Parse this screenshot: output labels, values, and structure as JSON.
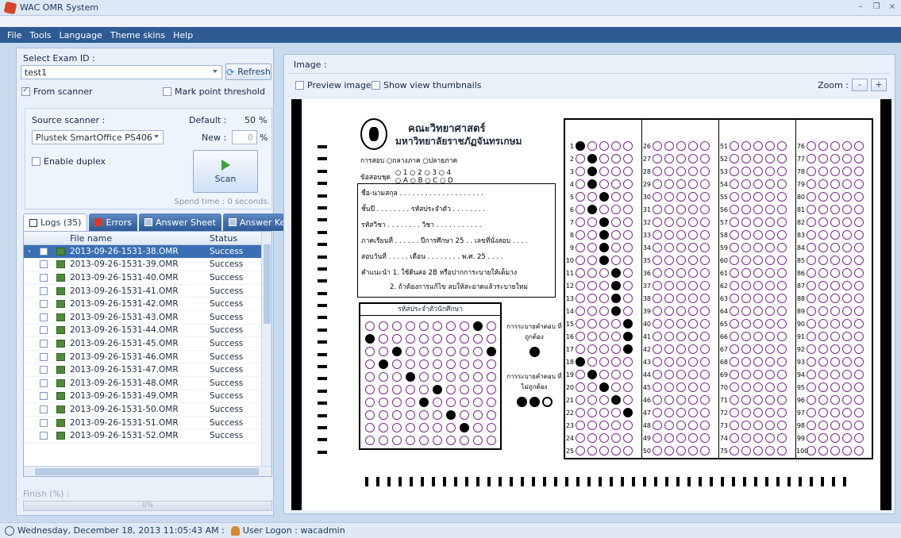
{
  "window": {
    "title": "WAC OMR System"
  },
  "menu": [
    "File",
    "Tools",
    "Language",
    "Theme skins",
    "Help"
  ],
  "left": {
    "select_exam_label": "Select Exam ID :",
    "exam_id": "test1",
    "refresh_label": "Refresh",
    "from_scanner_label": "From scanner",
    "from_scanner_checked": true,
    "mark_threshold_label": "Mark point threshold",
    "source_scanner_label": "Source scanner :",
    "source_scanner_value": "Plustek SmartOffice PS406",
    "default_label": "Default :",
    "default_value": "50",
    "new_label": "New :",
    "new_value": "0",
    "percent": "%",
    "enable_duplex_label": "Enable duplex",
    "scan_label": "Scan",
    "spend_time": "Spend time : 0 seconds.",
    "tabs": [
      {
        "label": "Logs (35)"
      },
      {
        "label": "Errors"
      },
      {
        "label": "Answer Sheet"
      },
      {
        "label": "Answer Key"
      }
    ],
    "columns": {
      "file": "File name",
      "status": "Status"
    },
    "rows": [
      {
        "file": "2013-09-26-1531-38.OMR",
        "status": "Success"
      },
      {
        "file": "2013-09-26-1531-39.OMR",
        "status": "Success"
      },
      {
        "file": "2013-09-26-1531-40.OMR",
        "status": "Success"
      },
      {
        "file": "2013-09-26-1531-41.OMR",
        "status": "Success"
      },
      {
        "file": "2013-09-26-1531-42.OMR",
        "status": "Success"
      },
      {
        "file": "2013-09-26-1531-43.OMR",
        "status": "Success"
      },
      {
        "file": "2013-09-26-1531-44.OMR",
        "status": "Success"
      },
      {
        "file": "2013-09-26-1531-45.OMR",
        "status": "Success"
      },
      {
        "file": "2013-09-26-1531-46.OMR",
        "status": "Success"
      },
      {
        "file": "2013-09-26-1531-47.OMR",
        "status": "Success"
      },
      {
        "file": "2013-09-26-1531-48.OMR",
        "status": "Success"
      },
      {
        "file": "2013-09-26-1531-49.OMR",
        "status": "Success"
      },
      {
        "file": "2013-09-26-1531-50.OMR",
        "status": "Success"
      },
      {
        "file": "2013-09-26-1531-51.OMR",
        "status": "Success"
      },
      {
        "file": "2013-09-26-1531-52.OMR",
        "status": "Success"
      }
    ],
    "finish_label": "Finish (%) :",
    "progress_text": "0%",
    "progress_value": 0
  },
  "right": {
    "image_label": "Image :",
    "preview_label": "Preview image",
    "thumbs_label": "Show view thumbnails",
    "zoom_label": "Zoom :",
    "zoom_out": "-",
    "zoom_in": "+",
    "sheet": {
      "faculty": "คณะวิทยาศาสตร์",
      "university": "มหาวิทยาลัยราชภัฏจันทรเกษม",
      "exam_type": "การสอบ  ○กลางภาค  ○ปลายภาค",
      "set_label": "ข้อสอบชุด",
      "set_options": "○ 1  ○ 2  ○ 3  ○ 4",
      "set_options2": "○ A  ○ B  ○ C  ○ D",
      "info_lines": [
        "ชื่อ-นามสกุล . . . . . . . . . . . . . . . . . . . .",
        "ชั้นปี . . . . . . . . รหัสประจำตัว . . . . . . . .",
        "รหัสวิชา . . . . . . . . วิชา . . . . . . . . . . .",
        "ภาคเรียนที่ . . . . . . ปีการศึกษา 25 . . เลขที่นั่งสอบ . . . .",
        "สอบวันที่ . . . . . เดือน . . . . . . . . พ.ศ. 25 . . . .",
        "คำแนะนำ 1. ใช้ดินสอ 2B หรือปากการะบายให้เต็มวง",
        "2. ถ้าต้องการแก้ไข ลบให้สะอาดแล้วระบายใหม่"
      ],
      "id_title": "รหัสประจำตัวนักศึกษา",
      "legend_ok": "การระบายคำตอบ ที่ถูกต้อง",
      "legend_bad": "การระบายคำตอบ ที่ไม่ถูกต้อง"
    }
  },
  "status": {
    "datetime": "Wednesday, December 18, 2013 11:05:43 AM :",
    "user": "User Logon : wacadmin"
  }
}
